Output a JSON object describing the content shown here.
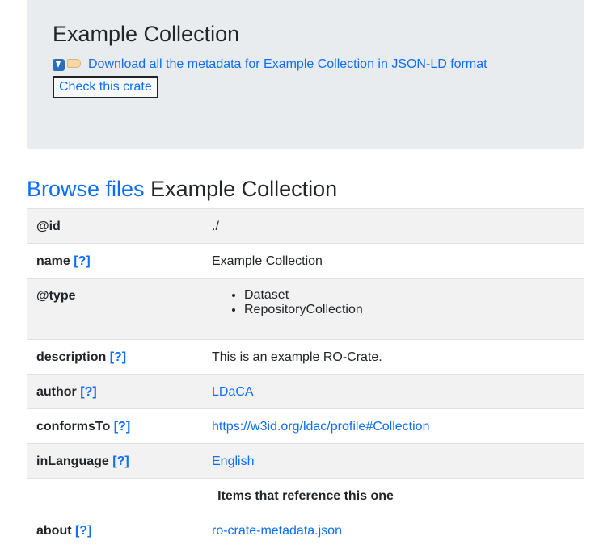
{
  "header": {
    "title": "Example Collection",
    "download_link": "Download all the metadata for Example Collection in JSON-LD format",
    "download_icons": [
      "download-arrow-icon",
      "tag-icon"
    ],
    "check_button": "Check this crate"
  },
  "browse": {
    "link": "Browse files",
    "title": "Example Collection"
  },
  "properties": {
    "help": "[?]",
    "id_key": "@id",
    "id_value": "./",
    "name_key": "name",
    "name_value": "Example Collection",
    "type_key": "@type",
    "types": [
      "Dataset",
      "RepositoryCollection"
    ],
    "description_key": "description",
    "description_value": "This is an example RO-Crate.",
    "author_key": "author",
    "author_value": "LDaCA",
    "conformsTo_key": "conformsTo",
    "conformsTo_value": "https://w3id.org/ldac/profile#Collection",
    "inLanguage_key": "inLanguage",
    "inLanguage_value": "English",
    "reference_heading": "Items that reference this one",
    "about_key": "about",
    "about_value": "ro-crate-metadata.json"
  },
  "colors": {
    "link": "#0d6efd",
    "header_background": "#e9ecef",
    "stripe": "#f2f2f2"
  }
}
